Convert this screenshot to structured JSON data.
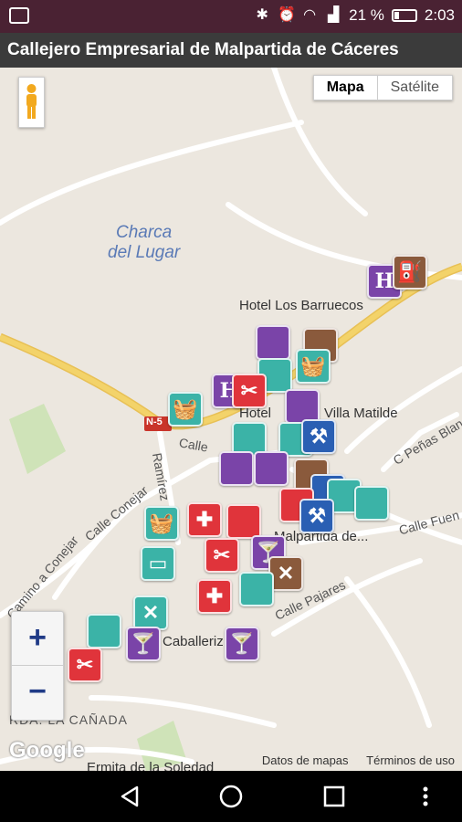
{
  "status_bar": {
    "battery_percent": "21 %",
    "time": "2:03"
  },
  "app": {
    "title": "Callejero Empresarial de Malpartida de Cáceres"
  },
  "map_type": {
    "map_label": "Mapa",
    "satellite_label": "Satélite",
    "selected": "Mapa"
  },
  "map_labels": {
    "water": "Charca\ndel Lugar",
    "hotel": "Hotel Los Barruecos",
    "villa": "Villa Matilde",
    "hotel_prefix": "Hotel",
    "road_n": "N-5",
    "calle_left": "Calle",
    "calle_conejar": "Calle Conejar",
    "ramirez": "Ramírez",
    "camino_conejar": "Camino a Conejar",
    "malpartida": "Malpartida de...",
    "calle_fuente": "Calle Fuen",
    "calle_penas": "C Peñas Blanca",
    "calle_pajares": "Calle Pajares",
    "caballeriza": "Caballeriz",
    "canada": "RDA. LA CAÑADA",
    "ermita": "Ermita de la Soledad"
  },
  "zoom": {
    "plus": "+",
    "minus": "−"
  },
  "attribution": {
    "logo": "Google",
    "map_data": "Datos de mapas",
    "terms": "Términos de uso"
  },
  "marker_icons": {
    "hotel": "H",
    "basket": "basket-icon",
    "scissors": "scissors-icon",
    "pharmacy": "cross-icon",
    "tools": "tools-icon",
    "worker": "worker-icon",
    "drink": "drink-icon",
    "computer": "computer-icon",
    "fuel": "fuel-icon"
  },
  "colors": {
    "status_bar": "#4a2233",
    "title_bar": "#3b3b3b",
    "teal": "#3bb3a7",
    "purple": "#7a44a8",
    "red": "#e0343b",
    "brown": "#8a5a3c",
    "blue": "#2a5fb3",
    "road": "#f3d36a"
  }
}
